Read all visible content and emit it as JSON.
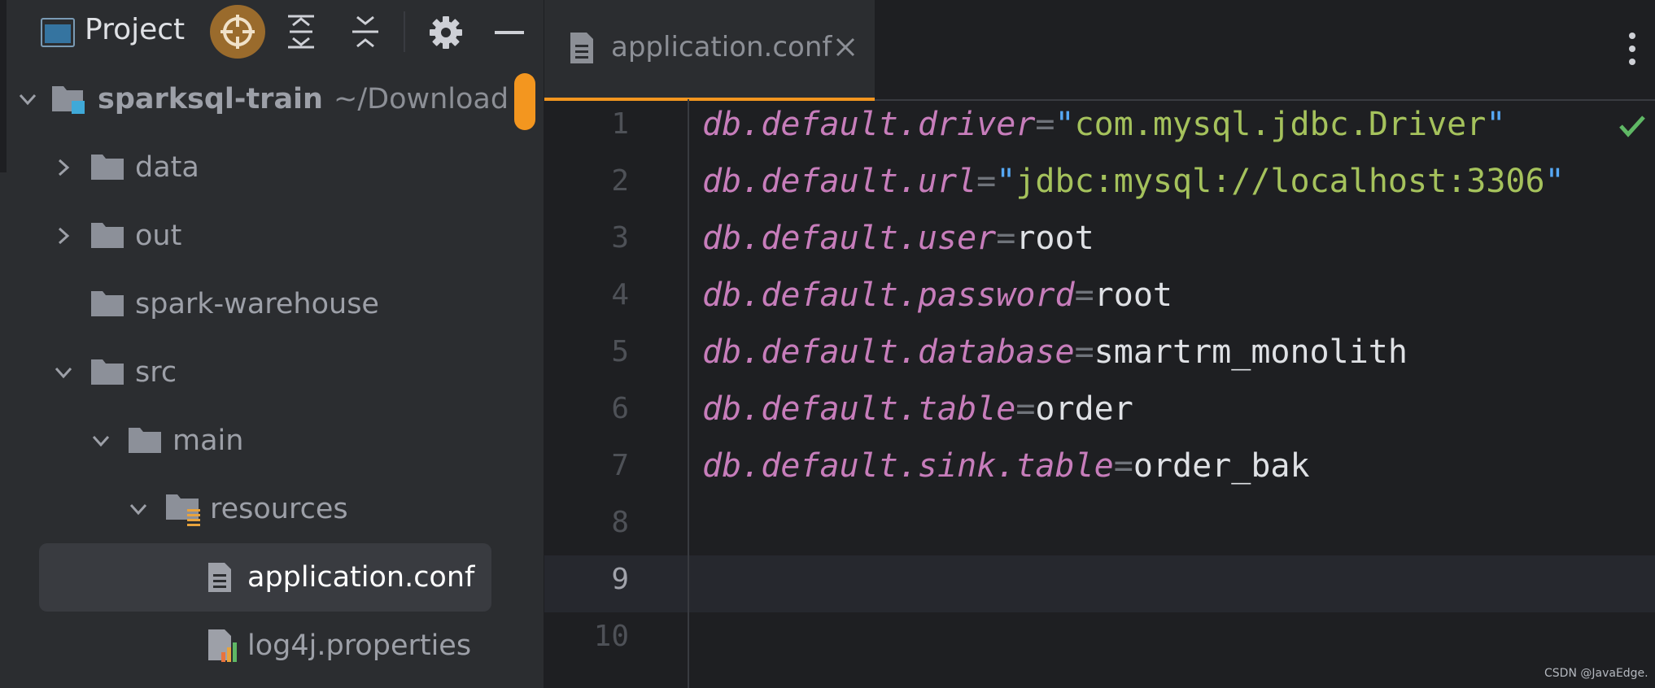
{
  "project_panel": {
    "title": "Project",
    "tree": [
      {
        "name": "sparksql-train",
        "path": "~/Download",
        "expanded": true,
        "kind": "project-root"
      },
      {
        "name": "data",
        "expanded": false,
        "kind": "folder"
      },
      {
        "name": "out",
        "expanded": false,
        "kind": "folder"
      },
      {
        "name": "spark-warehouse",
        "kind": "folder"
      },
      {
        "name": "src",
        "expanded": true,
        "kind": "folder"
      },
      {
        "name": "main",
        "expanded": true,
        "kind": "folder"
      },
      {
        "name": "resources",
        "expanded": true,
        "kind": "resources-folder"
      },
      {
        "name": "application.conf",
        "kind": "conf-file",
        "selected": true
      },
      {
        "name": "log4j.properties",
        "kind": "properties-file"
      }
    ],
    "icons": [
      "project-window-icon",
      "locate-icon",
      "expand-all-icon",
      "collapse-all-icon",
      "gear-icon",
      "minimize-icon"
    ]
  },
  "editor": {
    "tab": {
      "label": "application.conf",
      "close": "×"
    },
    "current_line": 9,
    "lines": [
      {
        "n": "1",
        "key": "db.default.driver",
        "eq": "=",
        "q1": "\"",
        "val": "com.mysql.jdbc.Driver",
        "q2": "\"",
        "type": "string"
      },
      {
        "n": "2",
        "key": "db.default.url",
        "eq": "=",
        "q1": "\"",
        "val": "jdbc:mysql://localhost:3306",
        "q2": "\"",
        "type": "string"
      },
      {
        "n": "3",
        "key": "db.default.user",
        "eq": "=",
        "val": "root",
        "type": "plain"
      },
      {
        "n": "4",
        "key": "db.default.password",
        "eq": "=",
        "val": "root",
        "type": "plain"
      },
      {
        "n": "5",
        "key": "db.default.database",
        "eq": "=",
        "val": "smartrm_monolith",
        "type": "plain"
      },
      {
        "n": "6",
        "key": "db.default.table",
        "eq": "=",
        "val": "order",
        "type": "plain"
      },
      {
        "n": "7",
        "key": "db.default.sink.table",
        "eq": "=",
        "val": "order_bak",
        "type": "plain"
      },
      {
        "n": "8"
      },
      {
        "n": "9"
      },
      {
        "n": "10"
      }
    ],
    "inspection_status": "check-icon",
    "colors": {
      "key": "#c77dbb",
      "string": "#a5c25c",
      "quote": "#56a8f5",
      "accent": "#f3961f",
      "ok": "#5fb865"
    }
  },
  "watermark": "CSDN @JavaEdge."
}
